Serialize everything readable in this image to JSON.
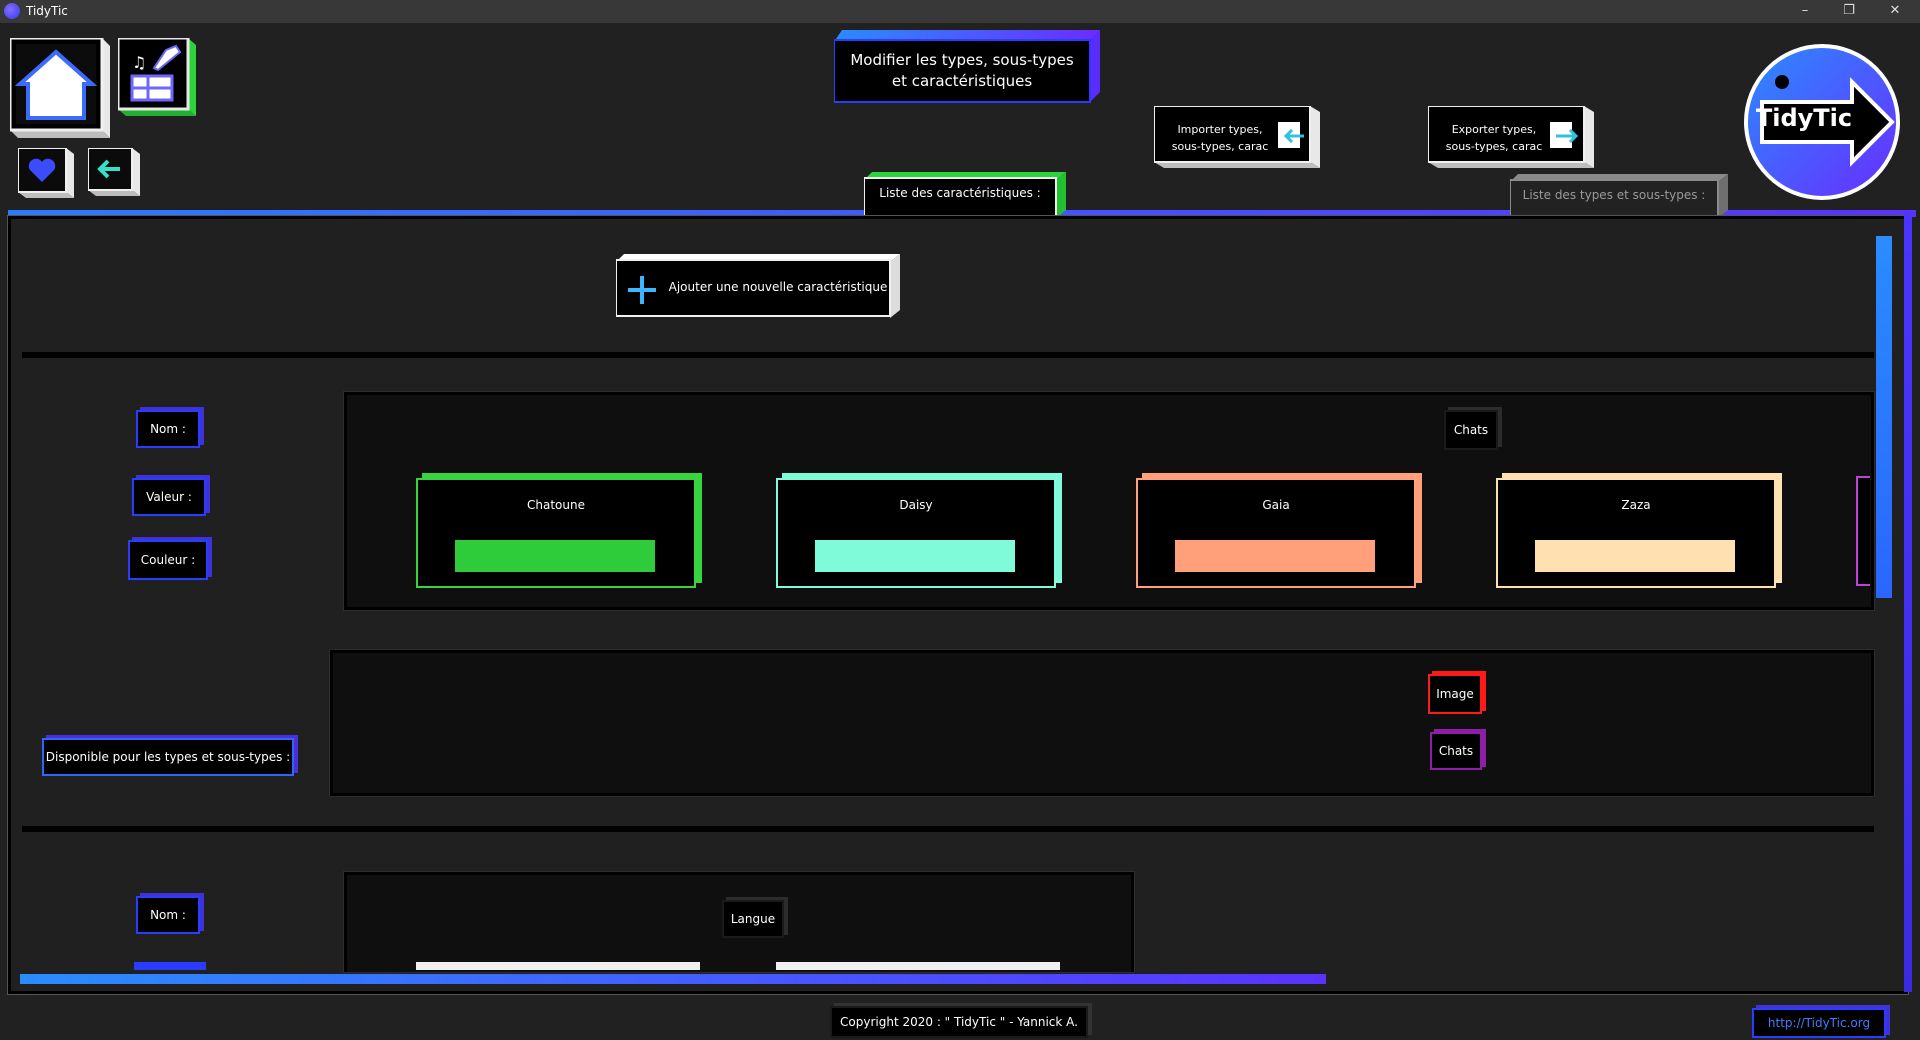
{
  "window": {
    "title": "TidyTic",
    "controls": [
      "–",
      "❐",
      "✕"
    ]
  },
  "header": {
    "page_title_line1": "Modifier les types, sous-types",
    "page_title_line2": "et caractéristiques",
    "import_line1": "Importer types,",
    "import_line2": "sous-types, carac",
    "export_line1": "Exporter types,",
    "export_line2": "sous-types, carac",
    "logo_text": "TidyTic"
  },
  "tabs": [
    {
      "label": "Liste des caractéristiques :",
      "active": true
    },
    {
      "label": "Liste des types et sous-types :",
      "active": false
    }
  ],
  "main": {
    "add_button_label": "Ajouter une nouvelle caractéristique",
    "char1": {
      "name_label": "Nom :",
      "value_label": "Valeur :",
      "color_label": "Couleur :",
      "name_value": "Chats",
      "values": [
        {
          "name": "Chatoune",
          "color": "#2ecc3a",
          "border": "#37d43f"
        },
        {
          "name": "Daisy",
          "color": "#7ffbd9",
          "border": "#7ffbd9"
        },
        {
          "name": "Gaia",
          "color": "#ffa07a",
          "border": "#ffa07a"
        },
        {
          "name": "Zaza",
          "color": "#ffe0b0",
          "border": "#ffe0b0"
        }
      ],
      "available_label": "Disponible pour les types et sous-types :",
      "available_types": [
        {
          "name": "Image",
          "color": "#ff1a1a"
        },
        {
          "name": "Chats",
          "color": "#8e1ea8"
        }
      ]
    },
    "char2": {
      "name_label": "Nom :",
      "name_value": "Langue"
    }
  },
  "footer": {
    "copyright": "Copyright 2020 : \" TidyTic \" - Yannick A.",
    "link": "http://TidyTic.org"
  }
}
